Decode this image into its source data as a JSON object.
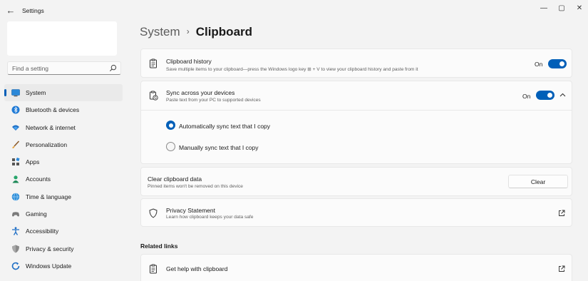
{
  "window": {
    "title": "Settings",
    "back_glyph": "←",
    "minimize_glyph": "—",
    "maximize_glyph": "▢",
    "close_glyph": "✕"
  },
  "sidebar": {
    "search_placeholder": "Find a setting",
    "items": [
      {
        "label": "System",
        "icon": "system-icon",
        "active": true
      },
      {
        "label": "Bluetooth & devices",
        "icon": "bluetooth-icon"
      },
      {
        "label": "Network & internet",
        "icon": "network-icon"
      },
      {
        "label": "Personalization",
        "icon": "personalization-icon"
      },
      {
        "label": "Apps",
        "icon": "apps-icon"
      },
      {
        "label": "Accounts",
        "icon": "accounts-icon"
      },
      {
        "label": "Time & language",
        "icon": "time-language-icon"
      },
      {
        "label": "Gaming",
        "icon": "gaming-icon"
      },
      {
        "label": "Accessibility",
        "icon": "accessibility-icon"
      },
      {
        "label": "Privacy & security",
        "icon": "privacy-security-icon"
      },
      {
        "label": "Windows Update",
        "icon": "windows-update-icon"
      }
    ]
  },
  "breadcrumb": {
    "parent": "System",
    "separator": "›",
    "current": "Clipboard"
  },
  "clipboard_history": {
    "title": "Clipboard history",
    "description": "Save multiple items to your clipboard—press the Windows logo key ⊞ + V to view your clipboard history and paste from it",
    "state_label": "On",
    "enabled": true
  },
  "sync": {
    "title": "Sync across your devices",
    "description": "Paste text from your PC to supported devices",
    "state_label": "On",
    "enabled": true,
    "expanded": true,
    "options": [
      {
        "label": "Automatically sync text that I copy",
        "selected": true
      },
      {
        "label": "Manually sync text that I copy",
        "selected": false
      }
    ]
  },
  "clear_data": {
    "title": "Clear clipboard data",
    "description": "Pinned items won't be removed on this device",
    "button_label": "Clear"
  },
  "privacy": {
    "title": "Privacy Statement",
    "description": "Learn how clipboard keeps your data safe"
  },
  "related_links": {
    "heading": "Related links",
    "items": [
      {
        "label": "Get help with clipboard"
      }
    ]
  },
  "colors": {
    "accent": "#005fb8",
    "background": "#f3f3f3",
    "card": "#fbfbfb"
  }
}
